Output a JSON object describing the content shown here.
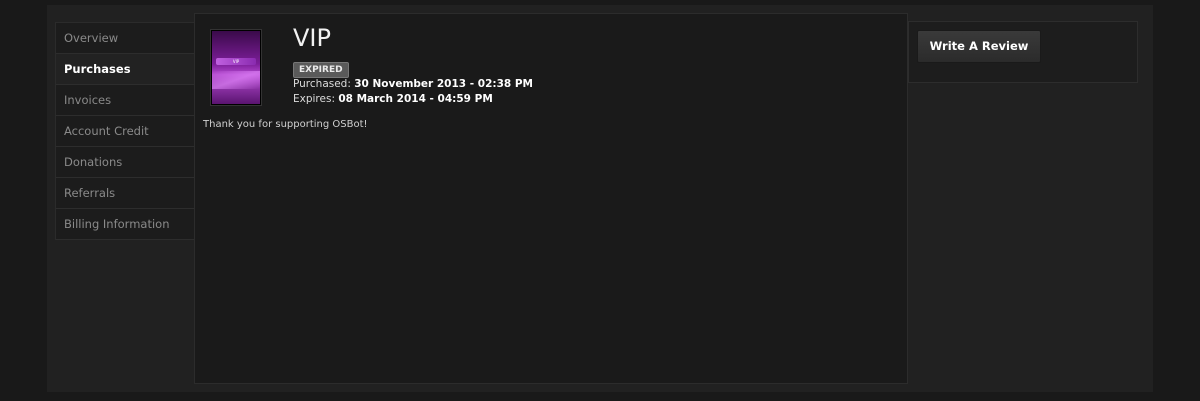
{
  "sidebar": {
    "items": [
      {
        "label": "Overview"
      },
      {
        "label": "Purchases"
      },
      {
        "label": "Invoices"
      },
      {
        "label": "Account Credit"
      },
      {
        "label": "Donations"
      },
      {
        "label": "Referrals"
      },
      {
        "label": "Billing Information"
      }
    ],
    "active_index": 1
  },
  "purchase": {
    "title": "VIP",
    "status_badge": "EXPIRED",
    "purchased_label": "Purchased: ",
    "purchased_value": "30 November 2013 - 02:38 PM",
    "expires_label": "Expires: ",
    "expires_value": "08 March 2014 - 04:59 PM",
    "message": "Thank you for supporting OSBot!",
    "thumbnail_text": "VIP"
  },
  "actions": {
    "write_review_label": "Write A Review"
  },
  "colors": {
    "background": "#191919",
    "accent_purple": "#8a2bb0",
    "badge_bg": "#5a5a5a"
  }
}
